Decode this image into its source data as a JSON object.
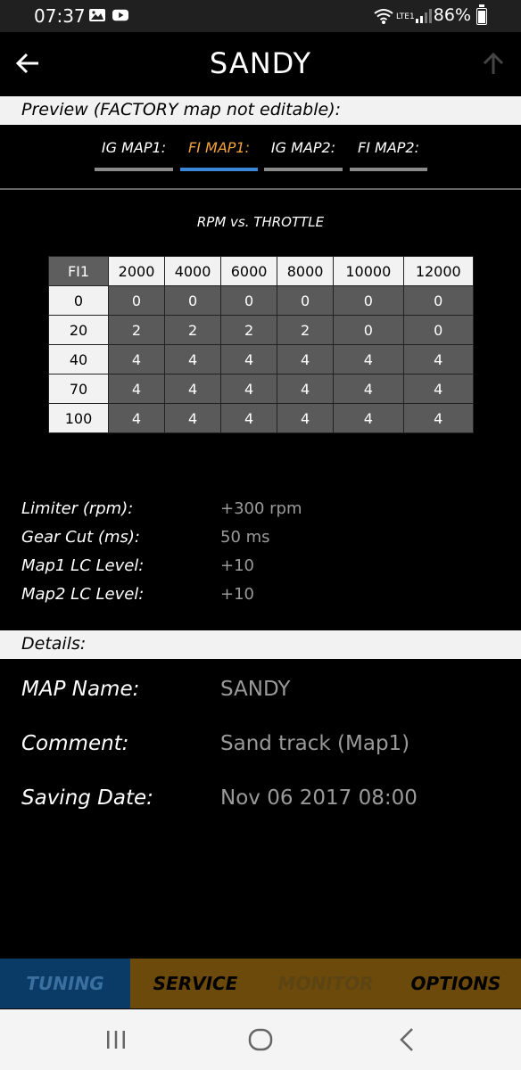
{
  "status": {
    "time": "07:37",
    "battery": "86%",
    "network": "LTE1"
  },
  "header": {
    "title": "SANDY"
  },
  "preview_band": {
    "text": "Preview (FACTORY map not editable):"
  },
  "tabs": [
    {
      "label": "IG MAP1:"
    },
    {
      "label": "FI MAP1:"
    },
    {
      "label": "IG MAP2:"
    },
    {
      "label": "FI MAP2:"
    }
  ],
  "table": {
    "title": "RPM vs. THROTTLE",
    "corner": "FI1",
    "columns": [
      "2000",
      "4000",
      "6000",
      "8000",
      "10000",
      "12000"
    ],
    "rows": [
      {
        "label": "0",
        "values": [
          "0",
          "0",
          "0",
          "0",
          "0",
          "0"
        ]
      },
      {
        "label": "20",
        "values": [
          "2",
          "2",
          "2",
          "2",
          "0",
          "0"
        ]
      },
      {
        "label": "40",
        "values": [
          "4",
          "4",
          "4",
          "4",
          "4",
          "4"
        ]
      },
      {
        "label": "70",
        "values": [
          "4",
          "4",
          "4",
          "4",
          "4",
          "4"
        ]
      },
      {
        "label": "100",
        "values": [
          "4",
          "4",
          "4",
          "4",
          "4",
          "4"
        ]
      }
    ]
  },
  "params": [
    {
      "label": "Limiter (rpm):",
      "value": "+300 rpm"
    },
    {
      "label": "Gear Cut (ms):",
      "value": "50 ms"
    },
    {
      "label": "Map1 LC Level:",
      "value": "+10"
    },
    {
      "label": "Map2 LC Level:",
      "value": "+10"
    }
  ],
  "details_band": {
    "text": "Details:"
  },
  "details": [
    {
      "label": "MAP Name:",
      "value": "SANDY"
    },
    {
      "label": "Comment:",
      "value": "Sand track (Map1)"
    },
    {
      "label": "Saving Date:",
      "value": "Nov 06 2017 08:00"
    }
  ],
  "bottom_tabs": [
    {
      "label": "TUNING"
    },
    {
      "label": "SERVICE"
    },
    {
      "label": "MONITOR"
    },
    {
      "label": "OPTIONS"
    }
  ],
  "colors": {
    "active_tab_text": "#f2a33a",
    "active_tab_underline": "#3a86d8",
    "tuning_bg": "#0a3a66",
    "tuning_text": "#3a6f9e",
    "brown_bg": "#6b4a0b",
    "monitor_text": "#5c4413"
  }
}
